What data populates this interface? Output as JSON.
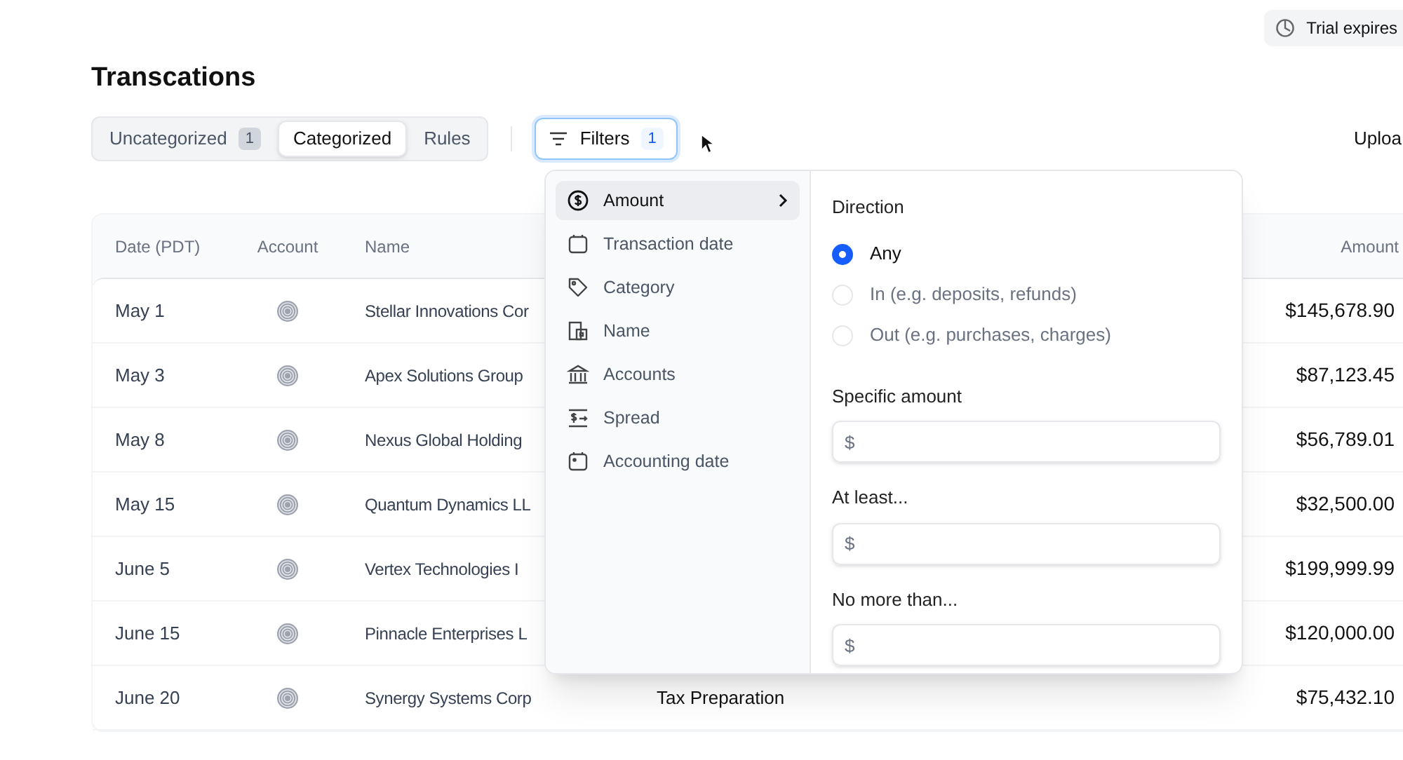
{
  "trial_badge": {
    "text": "Trial expires"
  },
  "title": "Transcations",
  "tabs": [
    {
      "label": "Uncategorized",
      "count": "1",
      "selected": false
    },
    {
      "label": "Categorized",
      "selected": true
    },
    {
      "label": "Rules",
      "selected": false
    }
  ],
  "filters_button": {
    "label": "Filters",
    "count": "1",
    "active": true
  },
  "upload_button": {
    "label": "Uploa"
  },
  "table": {
    "columns": [
      "Date (PDT)",
      "Account",
      "Name",
      "Amount"
    ],
    "rows": [
      {
        "date": "May 1",
        "name": "Stellar Innovations Cor",
        "amount": "$145,678.90"
      },
      {
        "date": "May 3",
        "name": "Apex Solutions Group",
        "amount": "$87,123.45"
      },
      {
        "date": "May 8",
        "name": "Nexus Global Holding",
        "amount": "$56,789.01"
      },
      {
        "date": "May 15",
        "name": "Quantum Dynamics LL",
        "amount": "$32,500.00"
      },
      {
        "date": "June 5",
        "name": "Vertex Technologies I",
        "amount": "$199,999.99"
      },
      {
        "date": "June 15",
        "name": "Pinnacle Enterprises L",
        "amount": "$120,000.00"
      },
      {
        "date": "June 20",
        "name": "Synergy Systems Corp",
        "category": "Tax Preparation",
        "amount": "$75,432.10"
      }
    ]
  },
  "filter_menu": {
    "items": [
      {
        "kind": "dollar",
        "label": "Amount",
        "selected": true
      },
      {
        "kind": "calendar",
        "label": "Transaction date",
        "selected": false
      },
      {
        "kind": "tag",
        "label": "Category",
        "selected": false
      },
      {
        "kind": "building",
        "label": "Name",
        "selected": false
      },
      {
        "kind": "bank",
        "label": "Accounts",
        "selected": false
      },
      {
        "kind": "spread",
        "label": "Spread",
        "selected": false
      },
      {
        "kind": "calendar-dot",
        "label": "Accounting date",
        "selected": false
      }
    ],
    "direction": {
      "title": "Direction",
      "options": [
        {
          "label": "Any",
          "selected": true
        },
        {
          "label": "In (e.g. deposits, refunds)",
          "selected": false
        },
        {
          "label": "Out (e.g. purchases, charges)",
          "selected": false
        }
      ]
    },
    "fields": [
      {
        "label": "Specific amount",
        "placeholder": "$"
      },
      {
        "label": "At least...",
        "placeholder": "$"
      },
      {
        "label": "No more than...",
        "placeholder": "$"
      }
    ]
  }
}
